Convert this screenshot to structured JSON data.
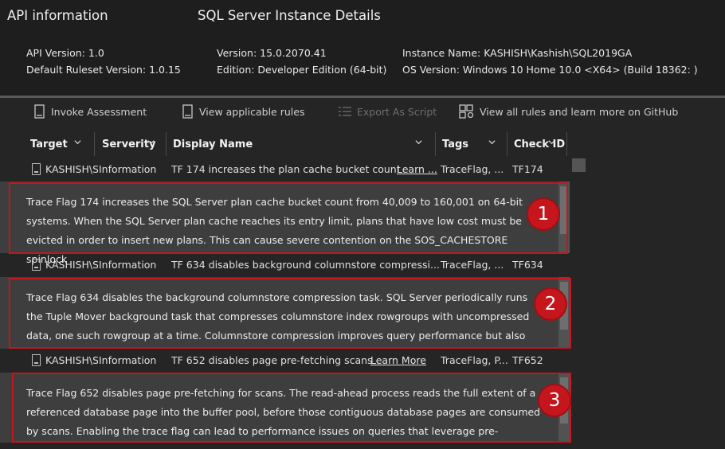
{
  "header": {
    "api_title": "API information",
    "instance_title": "SQL Server Instance Details",
    "api_version": "API Version: 1.0",
    "ruleset_version": "Default Ruleset Version: 1.0.15",
    "sql_version": "Version: 15.0.2070.41",
    "edition": "Edition: Developer Edition (64-bit)",
    "instance_name": "Instance Name: KASHISH\\Kashish\\SQL2019GA",
    "os_version": "OS Version: Windows 10 Home 10.0 <X64> (Build 18362: )"
  },
  "toolbar": {
    "invoke": "Invoke Assessment",
    "view_rules": "View applicable rules",
    "export": "Export As Script",
    "github": "View all rules and learn more on GitHub"
  },
  "columns": {
    "target": "Target",
    "severity": "Serverity",
    "display_name": "Display Name",
    "tags": "Tags",
    "check_id": "Check ID"
  },
  "rows": [
    {
      "target": "KASHISH\\S",
      "severity": "Information",
      "display_name": "TF 174 increases the plan cache bucket count",
      "link": "Learn ...",
      "tags": "TraceFlag, ...",
      "check_id": "TF174",
      "detail": "Trace Flag 174 increases the SQL Server plan cache bucket count from 40,009 to 160,001 on 64-bit systems. When the SQL Server plan cache reaches its entry limit, plans that have low cost must be evicted in order to insert new plans. This can cause severe contention on the SOS_CACHESTORE spinlock",
      "badge": "1"
    },
    {
      "target": "KASHISH\\S",
      "severity": "Information",
      "display_name": "TF 634 disables background columnstore compressi...",
      "link": "",
      "tags": "TraceFlag, ...",
      "check_id": "TF634",
      "detail": "Trace Flag 634 disables the background columnstore compression task. SQL Server periodically runs the Tuple Mover background task that compresses columnstore index rowgroups with uncompressed data, one such rowgroup at a time. Columnstore compression improves query performance but also",
      "badge": "2"
    },
    {
      "target": "KASHISH\\S",
      "severity": "Information",
      "display_name": "TF 652 disables page pre-fetching scans",
      "link": "Learn More",
      "tags": "TraceFlag, P...",
      "check_id": "TF652",
      "detail": "Trace Flag 652 disables page pre-fetching for scans. The read-ahead process reads the full extent of a referenced database page into the buffer pool, before those contiguous database pages are consumed by scans. Enabling the trace flag can lead to performance issues on queries that leverage pre-",
      "badge": "3"
    }
  ]
}
